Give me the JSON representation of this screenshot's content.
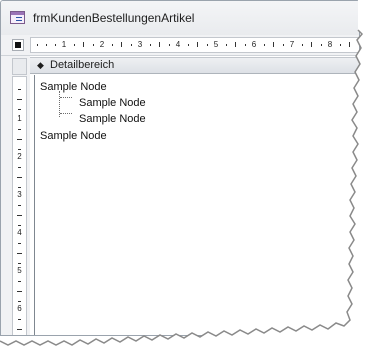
{
  "window": {
    "title": "frmKundenBestellungenArtikel"
  },
  "horizontal_ruler": {
    "labels": [
      "1",
      "2",
      "3",
      "4",
      "5",
      "6",
      "7",
      "8"
    ]
  },
  "vertical_ruler": {
    "labels": [
      "1",
      "2",
      "3",
      "4",
      "5",
      "6"
    ]
  },
  "section": {
    "label": "Detailbereich",
    "arrow": "◆"
  },
  "tree": {
    "nodes": [
      {
        "label": "Sample Node",
        "level": 0
      },
      {
        "label": "Sample Node",
        "level": 1
      },
      {
        "label": "Sample Node",
        "level": 1
      },
      {
        "label": "Sample Node",
        "level": 0
      }
    ]
  },
  "icons": {
    "window": "form-icon",
    "form_selector": "form-selector-icon",
    "section_arrow": "section-arrow-icon"
  },
  "colors": {
    "title_bar": "#eceef1",
    "ruler_background": "#ffffff",
    "section_header": "#e3e7eb",
    "tree_lines": "#6d6d6d",
    "canvas": "#ffffff"
  }
}
